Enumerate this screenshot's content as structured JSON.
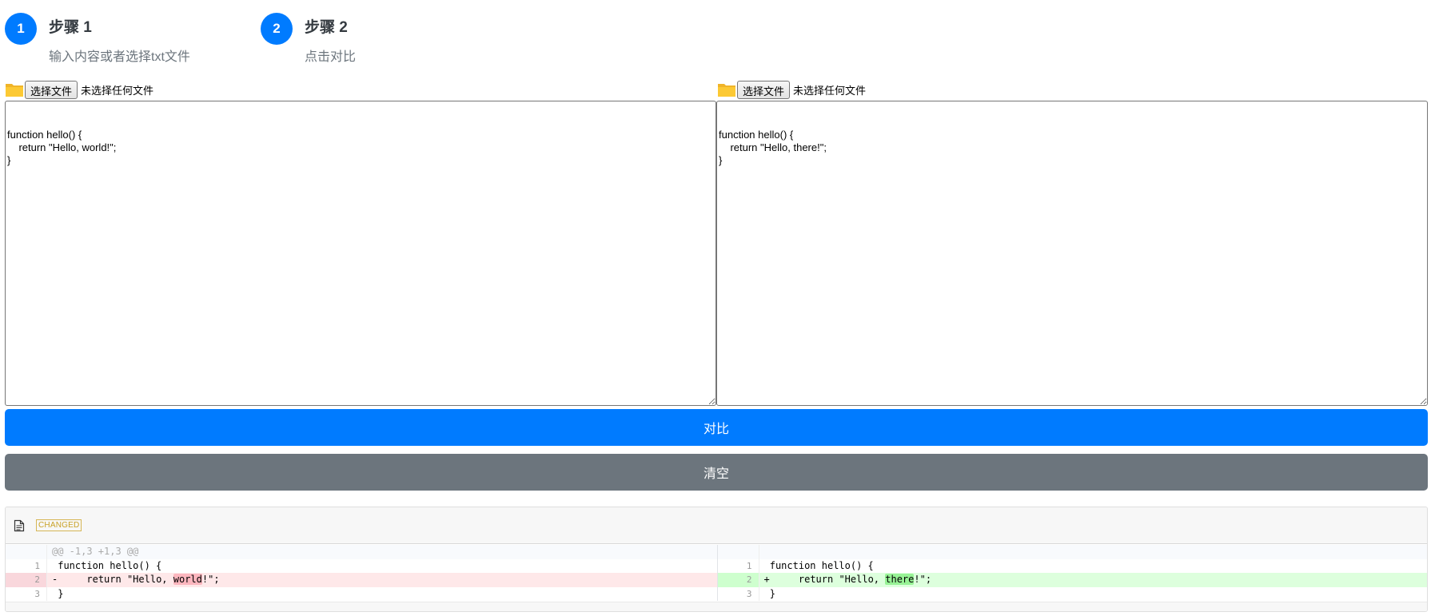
{
  "steps": [
    {
      "number": "1",
      "title": "步骤 1",
      "description": "输入内容或者选择txt文件"
    },
    {
      "number": "2",
      "title": "步骤 2",
      "description": "点击对比"
    }
  ],
  "file_inputs": {
    "left": {
      "button_label": "选择文件",
      "status": "未选择任何文件"
    },
    "right": {
      "button_label": "选择文件",
      "status": "未选择任何文件"
    }
  },
  "editors": {
    "left": "\nfunction hello() {\n    return \"Hello, world!\";\n}",
    "right": "\nfunction hello() {\n    return \"Hello, there!\";\n}"
  },
  "buttons": {
    "compare": "对比",
    "clear": "清空"
  },
  "colors": {
    "primary": "#007bff",
    "secondary": "#6c757d",
    "deleted_bg": "#fee8e9",
    "inserted_bg": "#ddffdd"
  },
  "diff": {
    "badge": "CHANGED",
    "hunk_header": "@@ -1,3 +1,3 @@",
    "left": {
      "l1": {
        "num": "1",
        "prefix": " ",
        "text": "function hello() {"
      },
      "l2": {
        "num": "2",
        "prefix": "-",
        "before": "    return \"Hello, ",
        "changed": "world",
        "after": "!\";"
      },
      "l3": {
        "num": "3",
        "prefix": " ",
        "text": "}"
      }
    },
    "right": {
      "l1": {
        "num": "1",
        "prefix": " ",
        "text": "function hello() {"
      },
      "l2": {
        "num": "2",
        "prefix": "+",
        "before": "    return \"Hello, ",
        "changed": "there",
        "after": "!\";"
      },
      "l3": {
        "num": "3",
        "prefix": " ",
        "text": "}"
      }
    }
  }
}
